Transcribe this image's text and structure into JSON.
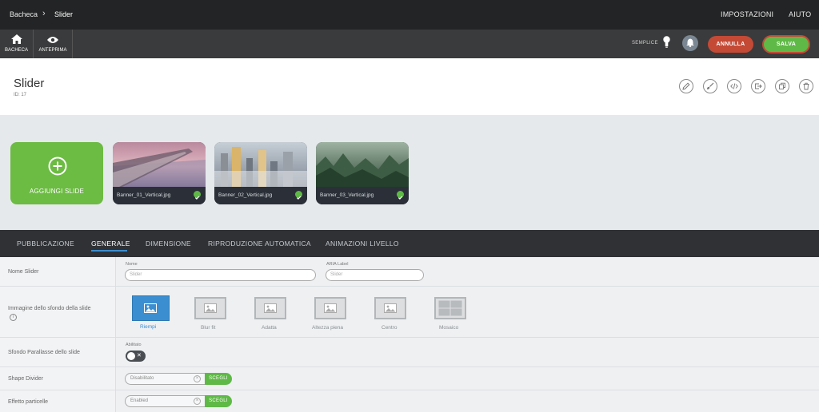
{
  "breadcrumb": {
    "root": "Bacheca",
    "current": "Slider"
  },
  "topnav": {
    "settings": "IMPOSTAZIONI",
    "help": "AIUTO"
  },
  "toolbar": {
    "home_label": "BACHECA",
    "preview_label": "ANTEPRIMA",
    "mode_label": "SEMPLICE",
    "cancel_label": "ANNULLA",
    "save_label": "SALVA"
  },
  "page": {
    "title": "Slider",
    "id_text": "ID: 17"
  },
  "action_icons": [
    "pencil-icon",
    "brush-icon",
    "code-icon",
    "export-icon",
    "duplicate-icon",
    "trash-icon"
  ],
  "slides": {
    "add_label": "AGGIUNGI SLIDE",
    "items": [
      {
        "name": "Banner_01_Vertical.jpg"
      },
      {
        "name": "Banner_02_Vertical.jpg"
      },
      {
        "name": "Banner_03_Vertical.jpg"
      }
    ]
  },
  "tabs": [
    "PUBBLICAZIONE",
    "GENERALE",
    "DIMENSIONE",
    "RIPRODUZIONE AUTOMATICA",
    "ANIMAZIONI LIVELLO"
  ],
  "active_tab": "GENERALE",
  "settings": {
    "name_row": {
      "label": "Nome Slider",
      "name_field_label": "Nome",
      "name_placeholder": "Slider",
      "aria_field_label": "ARIA Label",
      "aria_placeholder": "Slider"
    },
    "bg_row": {
      "label": "Immagine dello sfondo della slide",
      "options": [
        "Riempi",
        "Blur fit",
        "Adatta",
        "Altezza piena",
        "Centro",
        "Mosaico"
      ],
      "selected": "Riempi"
    },
    "parallax_row": {
      "label": "Sfondo Parallasse dello slide",
      "toggle_label": "Abilitato",
      "enabled": false
    },
    "shape_row": {
      "label": "Shape Divider",
      "value": "Disabilitato",
      "button": "SCEGLI"
    },
    "particle_row": {
      "label": "Effetto particelle",
      "value": "Enabled",
      "button": "SCEGLI"
    }
  },
  "colors": {
    "accent_blue": "#3b8ed0",
    "green": "#5fb946",
    "red": "#c44a36",
    "dark": "#232425"
  }
}
